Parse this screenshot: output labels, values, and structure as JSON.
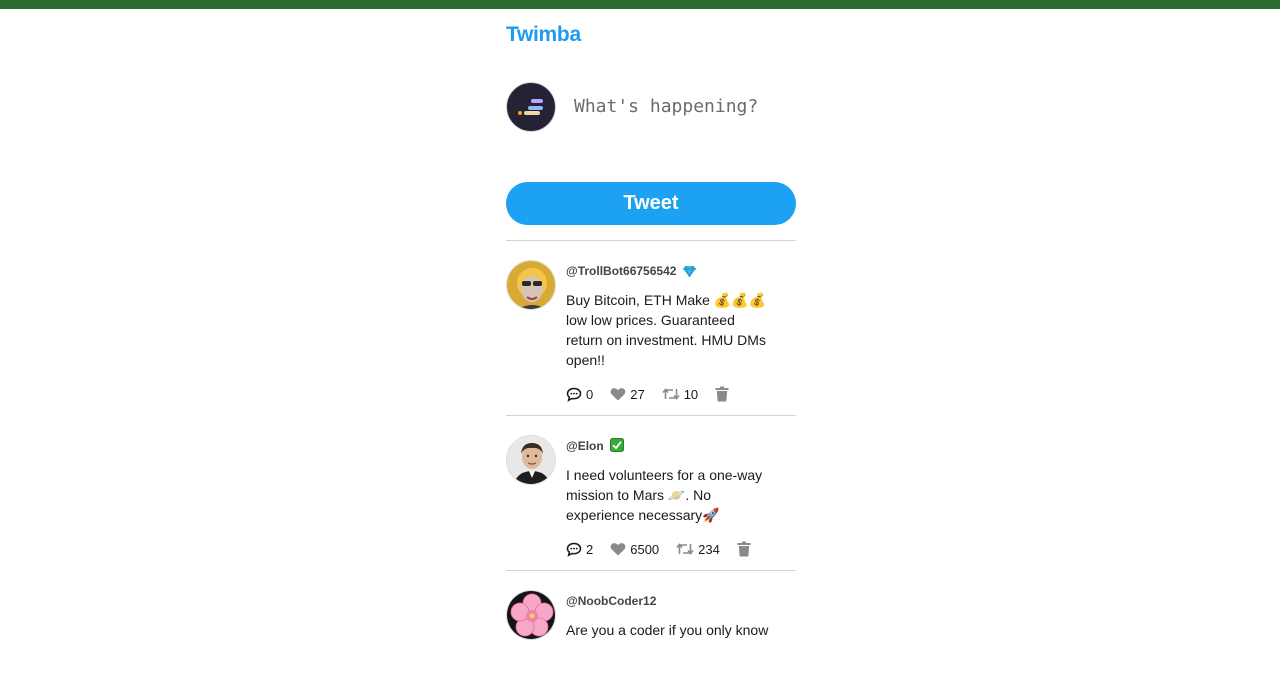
{
  "app": {
    "brand": "Twimba"
  },
  "composer": {
    "placeholder": "What's happening?",
    "tweet_button_label": "Tweet"
  },
  "colors": {
    "topbar": "#2d6a32",
    "brand": "#1d9bf0",
    "button": "#1da1f2"
  },
  "feed": [
    {
      "handle": "@TrollBot66756542",
      "badge_icon": "gem-icon",
      "text": "Buy Bitcoin, ETH Make 💰💰💰 low low prices. Guaranteed return on investment. HMU DMs open!!",
      "replies": "0",
      "likes": "27",
      "retweets": "10"
    },
    {
      "handle": "@Elon",
      "badge_icon": "check-mark-icon",
      "text": "I need volunteers for a one-way mission to Mars 🪐. No experience necessary🚀",
      "replies": "2",
      "likes": "6500",
      "retweets": "234"
    },
    {
      "handle": "@NoobCoder12",
      "text": "Are you a coder if you only know"
    }
  ]
}
